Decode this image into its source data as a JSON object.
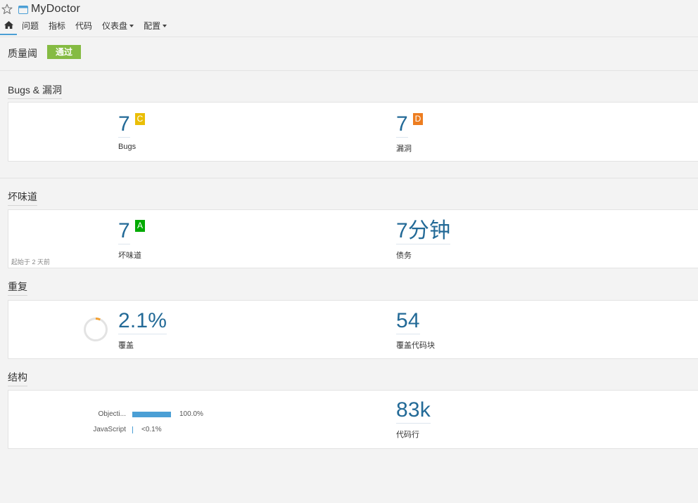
{
  "header": {
    "project_name": "MyDoctor",
    "nav": [
      {
        "label": "问题"
      },
      {
        "label": "指标"
      },
      {
        "label": "代码"
      },
      {
        "label": "仪表盘"
      },
      {
        "label": "配置"
      }
    ]
  },
  "quality_gate": {
    "title": "质量阈",
    "status": "通过",
    "status_color": "#85bb43"
  },
  "sections": {
    "bugs_vulnerabilities": {
      "title": "Bugs & 漏洞",
      "bugs": {
        "value": "7",
        "rating": "C",
        "rating_color": "#eabe06",
        "label": "Bugs"
      },
      "vulnerabilities": {
        "value": "7",
        "rating": "D",
        "rating_color": "#ed7d20",
        "label": "漏洞"
      }
    },
    "code_smells": {
      "title": "坏味道",
      "since": "起始于 2 天前",
      "smells": {
        "value": "7",
        "rating": "A",
        "rating_color": "#00aa00",
        "label": "坏味道"
      },
      "debt": {
        "value": "7分钟",
        "label": "债务"
      }
    },
    "duplications": {
      "title": "重复",
      "density": {
        "value": "2.1%",
        "percent": 2.1,
        "label": "覆盖"
      },
      "blocks": {
        "value": "54",
        "label": "覆盖代码块"
      }
    },
    "structure": {
      "title": "结构",
      "languages": [
        {
          "name": "Objecti...",
          "percent_label": "100.0%",
          "percent": 100.0
        },
        {
          "name": "JavaScript",
          "percent_label": "<0.1%",
          "percent": 0.1
        }
      ],
      "lines": {
        "value": "83k",
        "label": "代码行"
      }
    }
  },
  "colors": {
    "metric_value": "#236a97",
    "accent": "#4b9fd5"
  }
}
